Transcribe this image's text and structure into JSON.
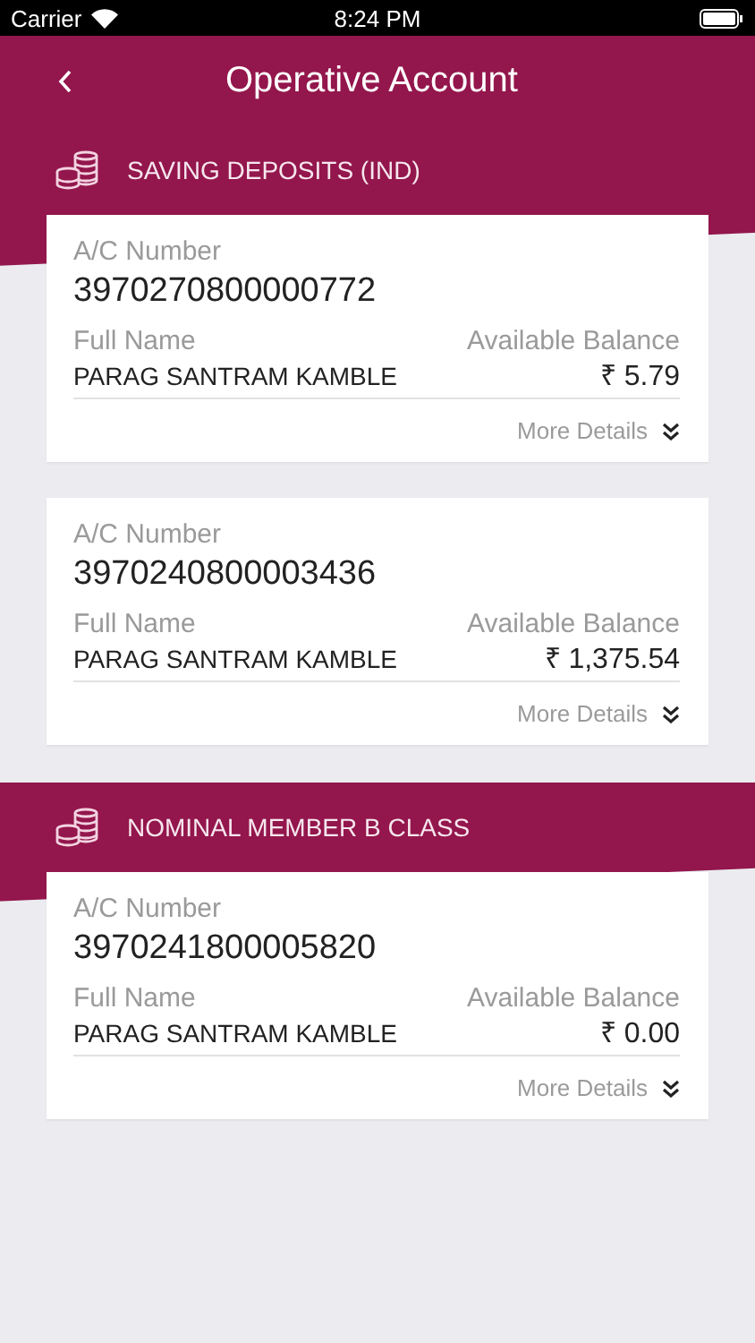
{
  "status_bar": {
    "carrier": "Carrier",
    "time": "8:24 PM"
  },
  "header": {
    "title": "Operative Account"
  },
  "sections": [
    {
      "title": "SAVING DEPOSITS (IND)",
      "accounts": [
        {
          "number_label": "A/C Number",
          "number": "3970270800000772",
          "name_label": "Full Name",
          "balance_label": "Available Balance",
          "name": "PARAG SANTRAM KAMBLE",
          "balance": "₹ 5.79",
          "more_label": "More Details"
        },
        {
          "number_label": "A/C Number",
          "number": "3970240800003436",
          "name_label": "Full Name",
          "balance_label": "Available Balance",
          "name": "PARAG SANTRAM KAMBLE",
          "balance": "₹ 1,375.54",
          "more_label": "More Details"
        }
      ]
    },
    {
      "title": "NOMINAL MEMBER B CLASS",
      "accounts": [
        {
          "number_label": "A/C Number",
          "number": "3970241800005820",
          "name_label": "Full Name",
          "balance_label": "Available Balance",
          "name": "PARAG SANTRAM KAMBLE",
          "balance": "₹ 0.00",
          "more_label": "More Details"
        }
      ]
    }
  ]
}
